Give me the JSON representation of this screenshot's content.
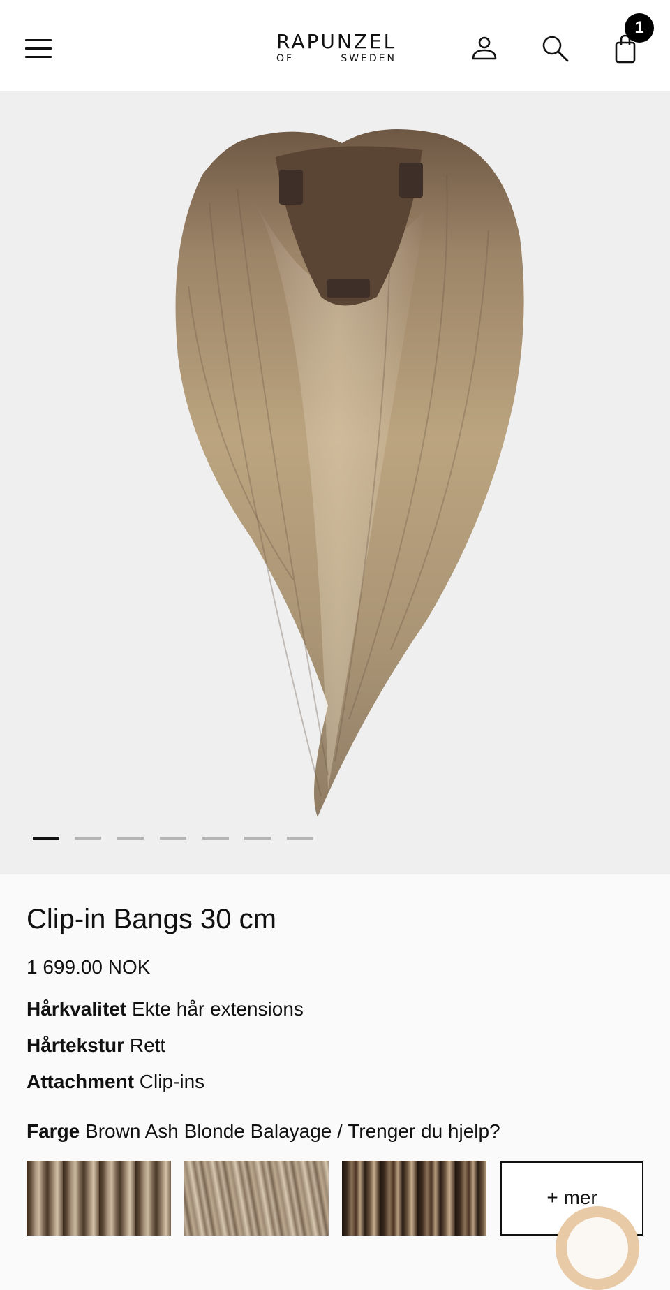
{
  "header": {
    "logo_top": "RAPUNZEL",
    "logo_of": "OF",
    "logo_sweden": "SWEDEN",
    "cart_count": "1",
    "icons": [
      "menu-icon",
      "user-icon",
      "search-icon",
      "shopping-bag-icon"
    ]
  },
  "gallery": {
    "image": "Clip-in bangs hairpiece, brown ash blonde balayage",
    "slide_count": 7,
    "active_slide": 1
  },
  "product": {
    "title": "Clip-in Bangs 30 cm",
    "price": "1 699.00 NOK",
    "attributes": [
      {
        "label": "Hårkvalitet",
        "value": "Ekte hår extensions"
      },
      {
        "label": "Hårtekstur",
        "value": "Rett"
      },
      {
        "label": "Attachment",
        "value": "Clip-ins"
      }
    ],
    "color_label": "Farge",
    "color_value": "Brown Ash Blonde Balayage / Trenger du hjelp?",
    "more_label": "+ mer"
  },
  "colors": {
    "gallery_bg": "#efefef",
    "badge": "#000000",
    "chat_bubble": "#e8caa6"
  }
}
